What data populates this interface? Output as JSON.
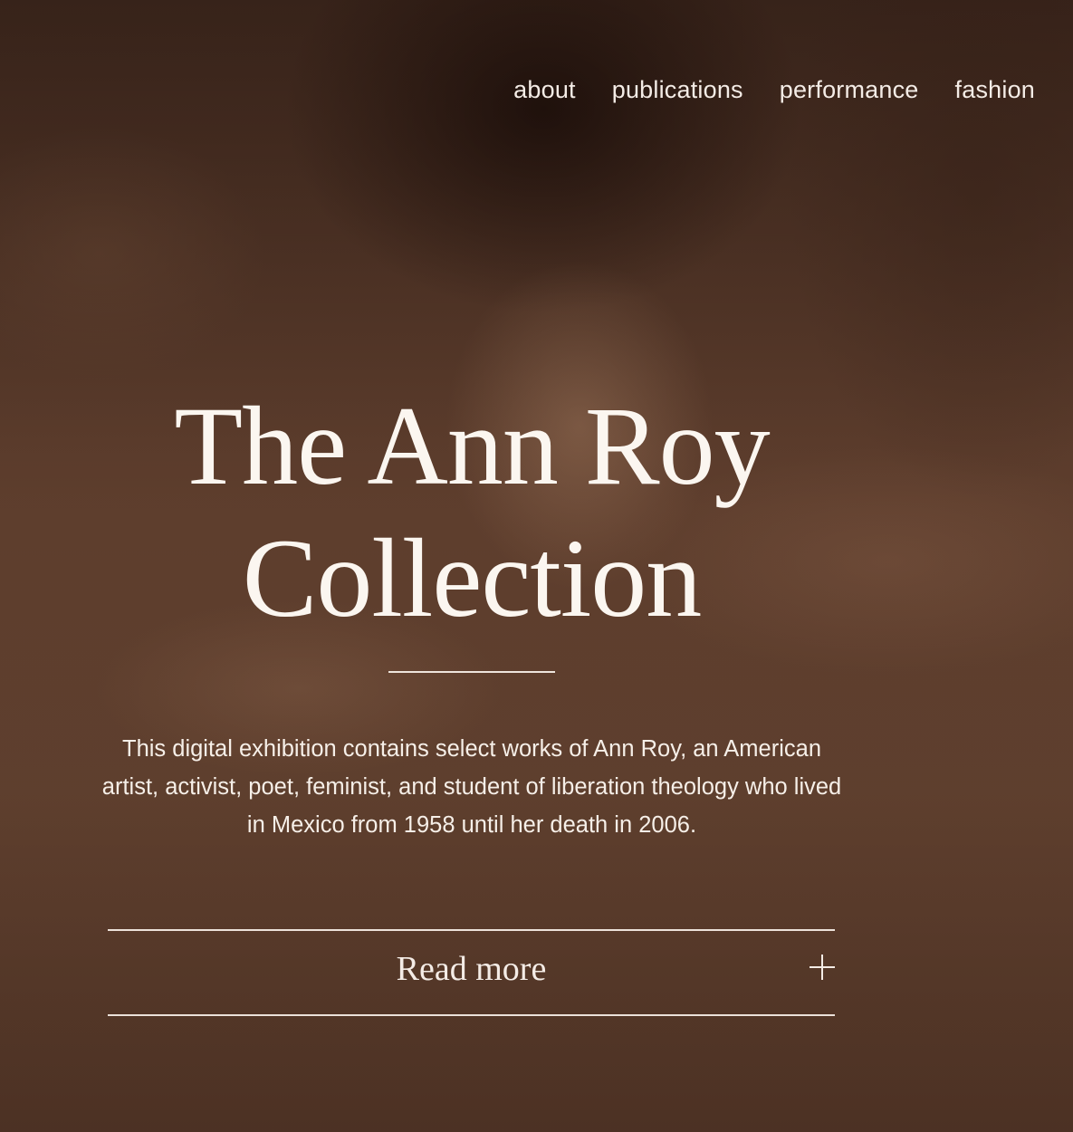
{
  "nav": {
    "items": [
      {
        "label": "about"
      },
      {
        "label": "publications"
      },
      {
        "label": "performance"
      },
      {
        "label": "fashion"
      }
    ]
  },
  "hero": {
    "title_line1": "The Ann Roy",
    "title_line2": "Collection",
    "description": "This digital exhibition contains select works of Ann Roy, an American artist, activist, poet, feminist, and student of liberation theology who lived in Mexico from 1958 until her death in 2006.",
    "read_more_label": "Read more",
    "expand_icon": "plus-icon"
  },
  "colors": {
    "text": "#fbf6f0",
    "background_tone": "#5b3c2c"
  }
}
